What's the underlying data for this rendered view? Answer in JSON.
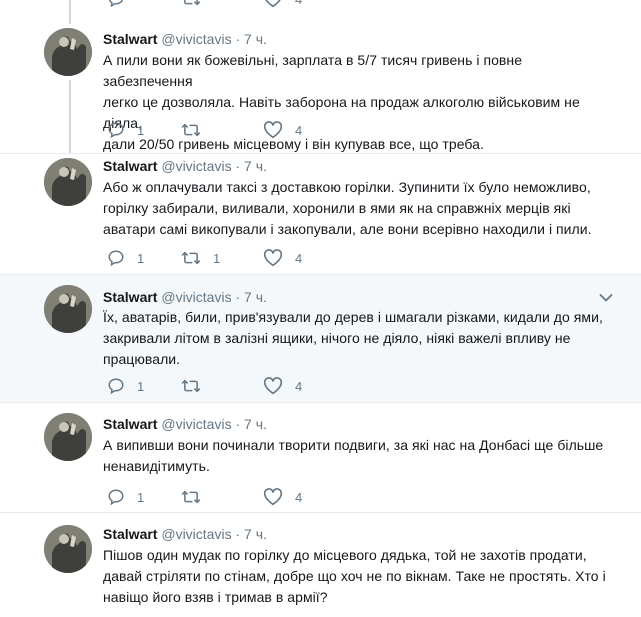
{
  "tweets": [
    {
      "name": "Stalwart",
      "handle": "@vivictavis",
      "dot": "·",
      "time": "7 ч.",
      "lines": [
        "А пили вони як божевільні, зарплата в 5/7 тисяч гривень і повне забезпечення",
        "легко це дозволяла. Навіть заборона на продаж алкоголю військовим не діяла,",
        "дали 20/50 гривень місцевому і він купував все, що треба."
      ],
      "replies": "1",
      "retweets": "",
      "likes": "4"
    },
    {
      "name": "Stalwart",
      "handle": "@vivictavis",
      "dot": "·",
      "time": "7 ч.",
      "lines": [
        "Або ж оплачували таксі з доставкою горілки. Зупинити їх було неможливо,",
        "горілку забирали, виливали, хоронили в ями як на справжніх мерців які",
        "аватари самі викопували і закопували, але вони всерівно находили і пили."
      ],
      "replies": "1",
      "retweets": "1",
      "likes": "4"
    },
    {
      "name": "Stalwart",
      "handle": "@vivictavis",
      "dot": "·",
      "time": "7 ч.",
      "lines": [
        "Їх, аватарів, били, прив'язували до дерев і шмагали різками, кидали до ями,",
        "закривали літом в залізні ящики, нічого не діяло, ніякі важелі впливу не",
        "працювали."
      ],
      "replies": "1",
      "retweets": "",
      "likes": "4"
    },
    {
      "name": "Stalwart",
      "handle": "@vivictavis",
      "dot": "·",
      "time": "7 ч.",
      "lines": [
        "А випивши вони починали творити подвиги, за які нас на Донбасі ще більше",
        "ненавидітимуть."
      ],
      "replies": "1",
      "retweets": "",
      "likes": "4"
    },
    {
      "name": "Stalwart",
      "handle": "@vivictavis",
      "dot": "·",
      "time": "7 ч.",
      "lines": [
        "Пішов один мудак по горілку до місцевого дядька, той не захотів продати,",
        "давай стріляти по стінам, добре що хоч не по вікнам. Таке не простять. Хто і",
        "навіщо його взяв і тримав в армії?"
      ],
      "replies": "",
      "retweets": "",
      "likes": ""
    }
  ],
  "top_partial": {
    "likes": "4"
  },
  "icons": {
    "reply": "reply-icon",
    "retweet": "retweet-icon",
    "like": "heart-icon",
    "more": "chevron-down-icon"
  },
  "colors": {
    "text": "#14171a",
    "secondary": "#657786",
    "thread_line": "#ccd6dd",
    "highlight_bg": "#f5f8fa"
  }
}
